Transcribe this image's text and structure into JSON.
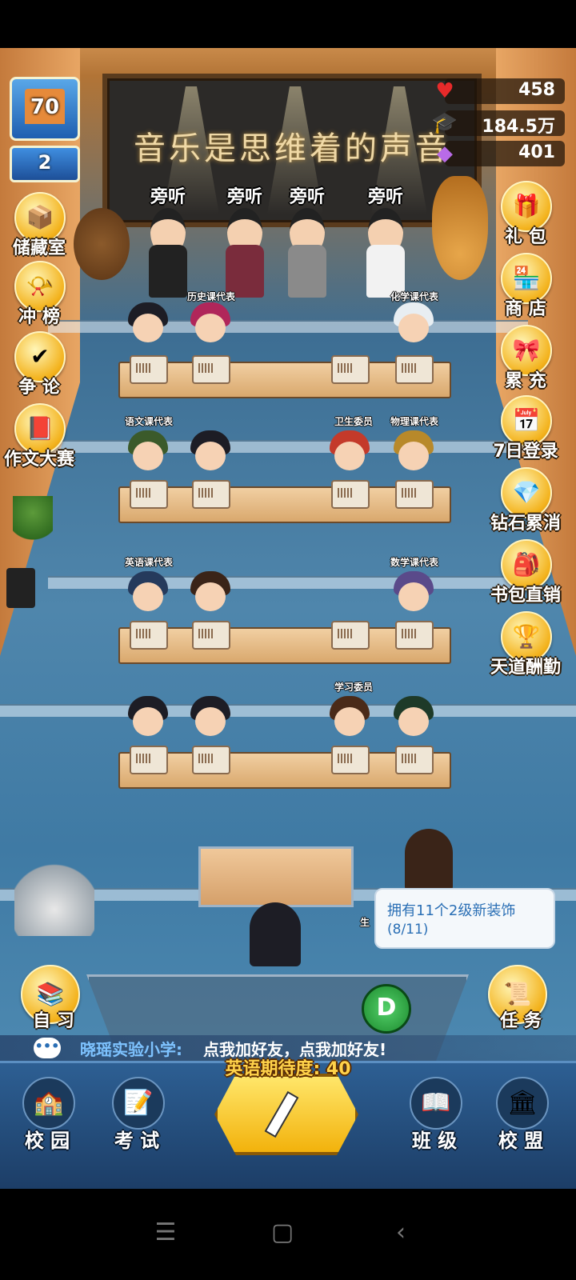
{
  "hud": {
    "school_level": "70",
    "rank": "2",
    "resources": [
      {
        "icon": "heart-icon",
        "value": "458"
      },
      {
        "icon": "graduation-cap-icon",
        "value": "184.5万"
      },
      {
        "icon": "diamond-icon",
        "value": "401"
      }
    ]
  },
  "chalkboard": {
    "title": "音乐是思维着的声音"
  },
  "listen_labels": [
    "旁听",
    "旁听",
    "旁听",
    "旁听"
  ],
  "left_menu": [
    {
      "label": "储藏室",
      "icon": "storage-box-icon"
    },
    {
      "label": "冲 榜",
      "icon": "trumpet-icon"
    },
    {
      "label": "争 论",
      "icon": "debate-icon"
    },
    {
      "label": "作文大赛",
      "icon": "essay-book-icon"
    }
  ],
  "right_menu": [
    {
      "label": "礼 包",
      "icon": "gift-pack-icon"
    },
    {
      "label": "商 店",
      "icon": "shop-icon"
    },
    {
      "label": "累 充",
      "icon": "gift-box-icon"
    },
    {
      "label": "7日登录",
      "icon": "calendar-icon"
    },
    {
      "label": "钻石累消",
      "icon": "diamond-pack-icon"
    },
    {
      "label": "书包直销",
      "icon": "schoolbag-icon"
    },
    {
      "label": "天道酬勤",
      "icon": "trophy-icon"
    }
  ],
  "roles": {
    "history": "历史课代表",
    "chemistry": "化学课代表",
    "chinese": "语文课代表",
    "hygiene": "卫生委员",
    "physics": "物理课代表",
    "english": "英语课代表",
    "math": "数学课代表",
    "study": "学习委员",
    "partial": "生"
  },
  "task_tip": {
    "title": "拥有11个2级新装饰",
    "progress": "(8/11)"
  },
  "self_study": {
    "label": "自 习"
  },
  "task": {
    "label": "任 务"
  },
  "d_button": "D",
  "chat": {
    "sender": "晓瑶实验小学:",
    "message": "点我加好友，点我加好友!"
  },
  "expectation": "英语期待度: 40",
  "bottom_nav": [
    {
      "label": "校 园",
      "icon": "campus-icon"
    },
    {
      "label": "考 试",
      "icon": "exam-paper-icon"
    },
    {
      "label": "班 级",
      "icon": "class-book-icon"
    },
    {
      "label": "校 盟",
      "icon": "school-alliance-icon"
    }
  ]
}
